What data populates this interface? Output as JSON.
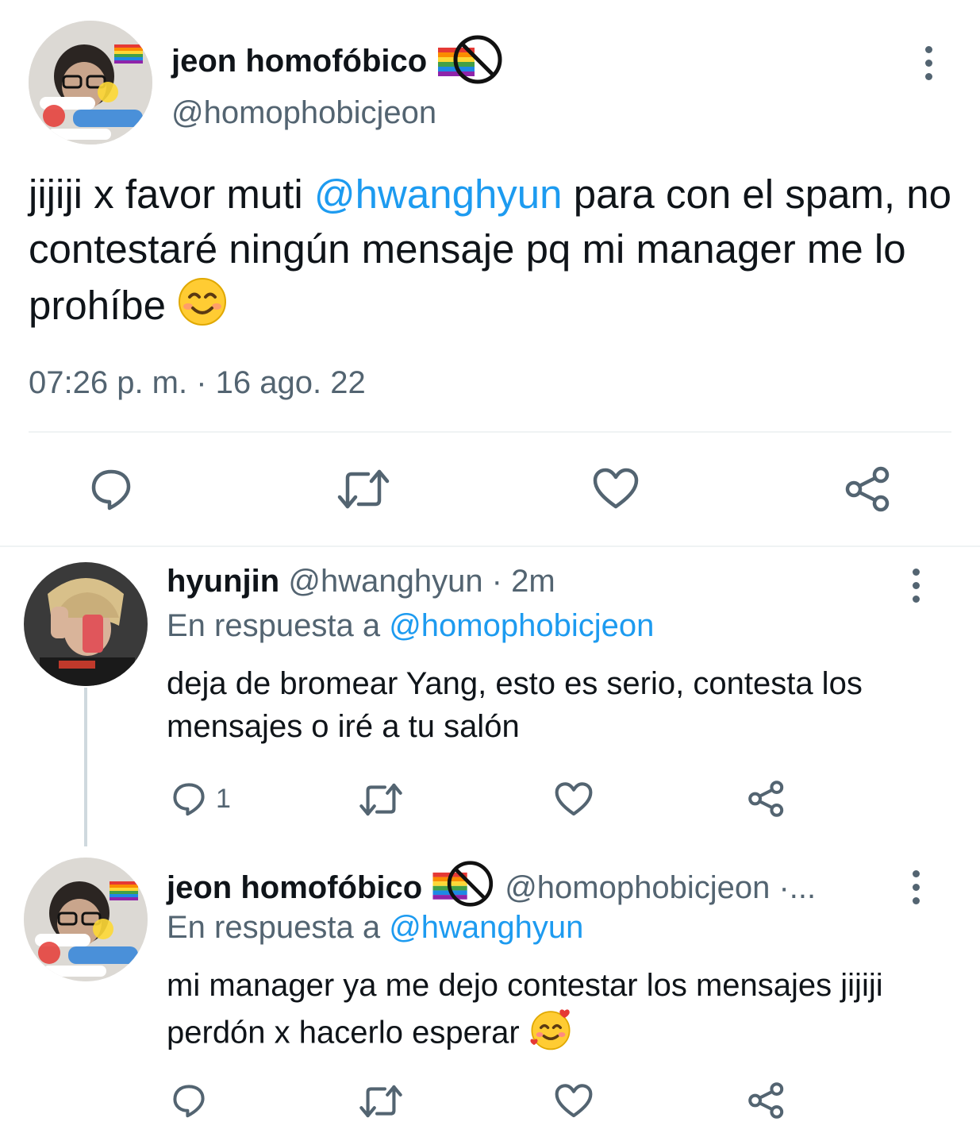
{
  "main_tweet": {
    "display_name": "jeon homofóbico",
    "name_emoji": "no-rainbow-flag-emoji",
    "handle": "@homophobicjeon",
    "text_before": "jijiji x favor muti ",
    "mention": "@hwanghyun",
    "text_after": " para con el spam, no contestaré ningún mensaje pq mi manager me lo prohíbe",
    "text_emoji": "smiling-face-emoji",
    "timestamp": "07:26 p. m. · 16 ago. 22",
    "more_icon": "more-vertical-icon",
    "actions": [
      {
        "icon": "reply-icon"
      },
      {
        "icon": "retweet-icon"
      },
      {
        "icon": "like-icon"
      },
      {
        "icon": "share-icon"
      }
    ]
  },
  "replies": [
    {
      "display_name": "hyunjin",
      "handle_time": "@hwanghyun · 2m",
      "reply_prefix": "En respuesta a ",
      "reply_to": "@homophobicjeon",
      "text": "deja de bromear Yang, esto es serio,  contesta los mensajes o iré a tu salón",
      "reply_count": "1"
    },
    {
      "display_name": "jeon homofóbico",
      "handle_time": "@homophobicjeon ·...",
      "reply_prefix": "En respuesta a ",
      "reply_to": "@hwanghyun",
      "text": "mi manager ya me dejo contestar los mensajes jijiji perdón x hacerlo esperar",
      "text_emoji": "smiling-face-with-hearts-emoji",
      "reply_count": ""
    }
  ],
  "colors": {
    "accent": "#1d9bf0",
    "text": "#0f1419",
    "muted": "#536471",
    "divider": "#eff3f4"
  }
}
